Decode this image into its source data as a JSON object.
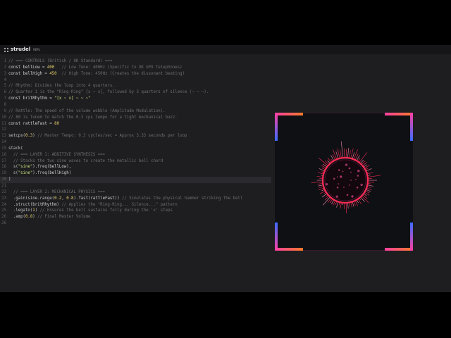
{
  "header": {
    "brand": "strudel",
    "subtitle": "REPL"
  },
  "editor": {
    "lines": [
      {
        "num": "1",
        "segs": [
          [
            "c",
            "// === CONTROLS (British / UK Standard) ==="
          ]
        ]
      },
      {
        "num": "2",
        "segs": [
          [
            "k",
            "const "
          ],
          [
            "v",
            "bellLow"
          ],
          [
            "k",
            " = "
          ],
          [
            "n",
            "400"
          ],
          [
            "c",
            "   // Low Tone: 400Hz (Specific to UK GPO Telephones)"
          ]
        ]
      },
      {
        "num": "3",
        "segs": [
          [
            "k",
            "const "
          ],
          [
            "v",
            "bellHigh"
          ],
          [
            "k",
            " = "
          ],
          [
            "n",
            "450"
          ],
          [
            "c",
            "  // High Tone: 450Hz (Creates the dissonant beating)"
          ]
        ]
      },
      {
        "num": "4",
        "segs": []
      },
      {
        "num": "5",
        "segs": [
          [
            "c",
            "// Rhythm: Divides the loop into 4 quarters."
          ]
        ]
      },
      {
        "num": "6",
        "segs": [
          [
            "c",
            "// Quarter 1 is the \"Ring-Ring\" [x ~ x], followed by 3 quarters of silence (~ ~ ~)."
          ]
        ]
      },
      {
        "num": "7",
        "segs": [
          [
            "k",
            "const "
          ],
          [
            "v",
            "britRhythm"
          ],
          [
            "k",
            " = "
          ],
          [
            "s",
            "\"[x ~ x] ~ ~ ~\""
          ]
        ]
      },
      {
        "num": "8",
        "segs": []
      },
      {
        "num": "9",
        "segs": [
          [
            "c",
            "// Rattle: The speed of the volume wobble (Amplitude Modulation)."
          ]
        ]
      },
      {
        "num": "10",
        "segs": [
          [
            "c",
            "// 80 is tuned to match the 0.3 cps tempo for a tight mechanical buzz."
          ]
        ]
      },
      {
        "num": "11",
        "segs": [
          [
            "k",
            "const "
          ],
          [
            "v",
            "rattleFast"
          ],
          [
            "k",
            " = "
          ],
          [
            "n",
            "80"
          ]
        ]
      },
      {
        "num": "12",
        "segs": []
      },
      {
        "num": "13",
        "segs": [
          [
            "f",
            "setcps("
          ],
          [
            "n",
            "0.3"
          ],
          [
            "f",
            ")"
          ],
          [
            "c",
            " // Master Tempo: 0.3 cycles/sec = Approx 3.33 seconds per loop"
          ]
        ]
      },
      {
        "num": "14",
        "segs": []
      },
      {
        "num": "15",
        "segs": [
          [
            "f",
            "stack("
          ]
        ]
      },
      {
        "num": "16",
        "segs": [
          [
            "c",
            "  // === LAYER 1: ADDITIVE SYNTHESIS ==="
          ]
        ]
      },
      {
        "num": "17",
        "segs": [
          [
            "c",
            "  // Stacks the two sine waves to create the metallic bell chord"
          ]
        ]
      },
      {
        "num": "18",
        "segs": [
          [
            "f",
            "  s("
          ],
          [
            "s",
            "\"sine\""
          ],
          [
            "f",
            ").freq("
          ],
          [
            "v",
            "bellLow"
          ],
          [
            "f",
            "),"
          ]
        ]
      },
      {
        "num": "19",
        "segs": [
          [
            "f",
            "  s("
          ],
          [
            "s",
            "\"sine\""
          ],
          [
            "f",
            ").freq("
          ],
          [
            "v",
            "bellHigh"
          ],
          [
            "f",
            ")"
          ]
        ]
      },
      {
        "num": "20",
        "segs": [
          [
            "f",
            ")"
          ]
        ],
        "hl": true
      },
      {
        "num": "21",
        "segs": []
      },
      {
        "num": "22",
        "segs": [
          [
            "c",
            "  // === LAYER 2: MECHANICAL PHYSICS ==="
          ]
        ]
      },
      {
        "num": "23",
        "segs": [
          [
            "f",
            "  .gain(sine.range("
          ],
          [
            "n",
            "0.2"
          ],
          [
            "f",
            ", "
          ],
          [
            "n",
            "0.8"
          ],
          [
            "f",
            ").fast("
          ],
          [
            "v",
            "rattleFast"
          ],
          [
            "f",
            "))"
          ],
          [
            "c",
            " // Simulates the physical hammer striking the bell"
          ]
        ]
      },
      {
        "num": "24",
        "segs": [
          [
            "f",
            "  .struct("
          ],
          [
            "v",
            "britRhythm"
          ],
          [
            "f",
            ")"
          ],
          [
            "c",
            " // Applies the \"Ring-Ring... Silence...\" pattern"
          ]
        ]
      },
      {
        "num": "25",
        "segs": [
          [
            "f",
            "  .legato("
          ],
          [
            "n",
            "1"
          ],
          [
            "f",
            ")"
          ],
          [
            "c",
            " // Ensures the bell sustains fully during the 'x' steps"
          ]
        ]
      },
      {
        "num": "26",
        "segs": [
          [
            "f",
            "  .amp("
          ],
          [
            "n",
            "0.8"
          ],
          [
            "f",
            ")"
          ],
          [
            "c",
            " // Final Master Volume"
          ]
        ]
      },
      {
        "num": "26",
        "segs": []
      }
    ]
  },
  "viz": {
    "accent": "#ff2a55",
    "corner_pink": "#ff3fa0",
    "corner_orange": "#ff7a2a",
    "corner_blue": "#3a6bff"
  }
}
